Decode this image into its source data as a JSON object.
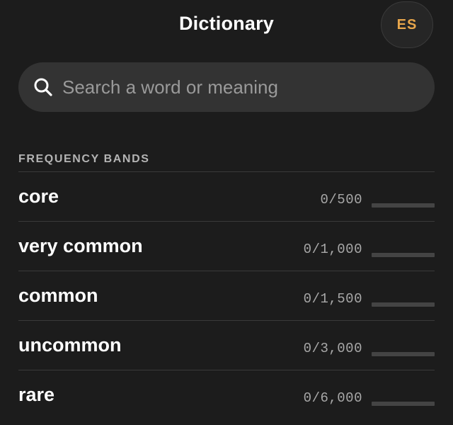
{
  "header": {
    "title": "Dictionary",
    "language_label": "ES"
  },
  "search": {
    "placeholder": "Search a word or meaning",
    "value": ""
  },
  "frequency": {
    "section_title": "FREQUENCY BANDS",
    "bands": [
      {
        "label": "core",
        "count": "0/500",
        "progress": 0
      },
      {
        "label": "very common",
        "count": "0/1,000",
        "progress": 0
      },
      {
        "label": "common",
        "count": "0/1,500",
        "progress": 0
      },
      {
        "label": "uncommon",
        "count": "0/3,000",
        "progress": 0
      },
      {
        "label": "rare",
        "count": "0/6,000",
        "progress": 0
      }
    ]
  },
  "colors": {
    "background": "#1c1c1c",
    "accent": "#e8a64b",
    "search_bg": "#333333",
    "progress_track": "#444444"
  },
  "icons": {
    "search": "search-icon"
  }
}
